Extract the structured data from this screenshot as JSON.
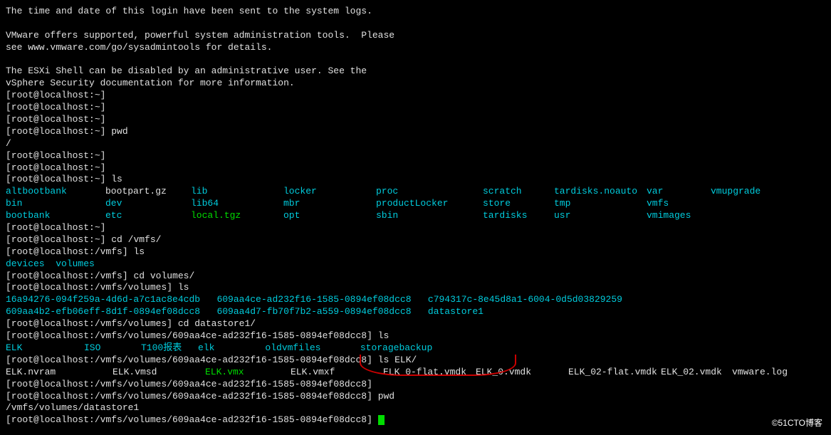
{
  "motd": {
    "l1": "The time and date of this login have been sent to the system logs.",
    "l2": "VMware offers supported, powerful system administration tools.  Please",
    "l3": "see www.vmware.com/go/sysadmintools for details.",
    "l4": "The ESXi Shell can be disabled by an administrative user. See the",
    "l5": "vSphere Security documentation for more information."
  },
  "prompts": {
    "p1": "[root@localhost:~]",
    "p2": "[root@localhost:~]",
    "p3": "[root@localhost:~]",
    "p4_prompt": "[root@localhost:~]",
    "p4_cmd": " pwd",
    "p4_out": "/",
    "p5": "[root@localhost:~]",
    "p6": "[root@localhost:~]",
    "p7_prompt": "[root@localhost:~]",
    "p7_cmd": " ls",
    "p8": "[root@localhost:~]",
    "p9_prompt": "[root@localhost:~]",
    "p9_cmd": " cd /vmfs/",
    "p10_prompt": "[root@localhost:/vmfs]",
    "p10_cmd": " ls",
    "p11_prompt": "[root@localhost:/vmfs]",
    "p11_cmd": " cd volumes/",
    "p12_prompt": "[root@localhost:/vmfs/volumes]",
    "p12_cmd": " ls",
    "p13_prompt": "[root@localhost:/vmfs/volumes]",
    "p13_cmd": " cd datastore1/",
    "p14_prompt": "[root@localhost:/vmfs/volumes/609aa4ce-ad232f16-1585-0894ef08dcc8]",
    "p14_cmd": " ls",
    "p15_prompt": "[root@localhost:/vmfs/volumes/609aa4ce-ad232f16-1585-0894ef08dcc8]",
    "p15_cmd": " ls ELK/",
    "p16": "[root@localhost:/vmfs/volumes/609aa4ce-ad232f16-1585-0894ef08dcc8]",
    "p17_prompt": "[root@localhost:/vmfs/volumes/609aa4ce-ad232f16-1585-0894ef08dcc8]",
    "p17_cmd": " pwd",
    "p17_out": "/vmfs/volumes/datastore1",
    "p18": "[root@localhost:/vmfs/volumes/609aa4ce-ad232f16-1585-0894ef08dcc8]"
  },
  "ls_root": {
    "r1c1": "altbootbank",
    "r1c2": "bootpart.gz",
    "r1c3": "lib",
    "r1c4": "locker",
    "r1c5": "proc",
    "r1c6": "scratch",
    "r1c7": "tardisks.noauto",
    "r1c8": "var",
    "r1c9": "vmupgrade",
    "r2c1": "bin",
    "r2c2": "dev",
    "r2c3": "lib64",
    "r2c4": "mbr",
    "r2c5": "productLocker",
    "r2c6": "store",
    "r2c7": "tmp",
    "r2c8": "vmfs",
    "r3c1": "bootbank",
    "r3c2": "etc",
    "r3c3": "local.tgz",
    "r3c4": "opt",
    "r3c5": "sbin",
    "r3c6": "tardisks",
    "r3c7": "usr",
    "r3c8": "vmimages"
  },
  "ls_vmfs": {
    "c1": "devices",
    "c2": "volumes"
  },
  "ls_volumes": {
    "v1": "16a94276-094f259a-4d6d-a7c1ac8e4cdb",
    "v2": "609aa4ce-ad232f16-1585-0894ef08dcc8",
    "v3": "c794317c-8e45d8a1-6004-0d5d03829259",
    "v4": "609aa4b2-efb06eff-8d1f-0894ef08dcc8",
    "v5": "609aa4d7-fb70f7b2-a559-0894ef08dcc8",
    "v6": "datastore1"
  },
  "ls_ds1": {
    "c1": "ELK",
    "c2": "ISO",
    "c3": "T100报表",
    "c4": "elk",
    "c5": "oldvmfiles",
    "c6": "storagebackup"
  },
  "ls_elk": {
    "f1": "ELK.nvram",
    "f2": "ELK.vmsd",
    "f3": "ELK.vmx",
    "f4": "ELK.vmxf",
    "f5": "ELK_0-flat.vmdk",
    "f6": "ELK_0.vmdk",
    "f7": "ELK_02-flat.vmdk",
    "f8": "ELK_02.vmdk",
    "f9": "vmware.log"
  },
  "watermark": "©51CTO博客"
}
